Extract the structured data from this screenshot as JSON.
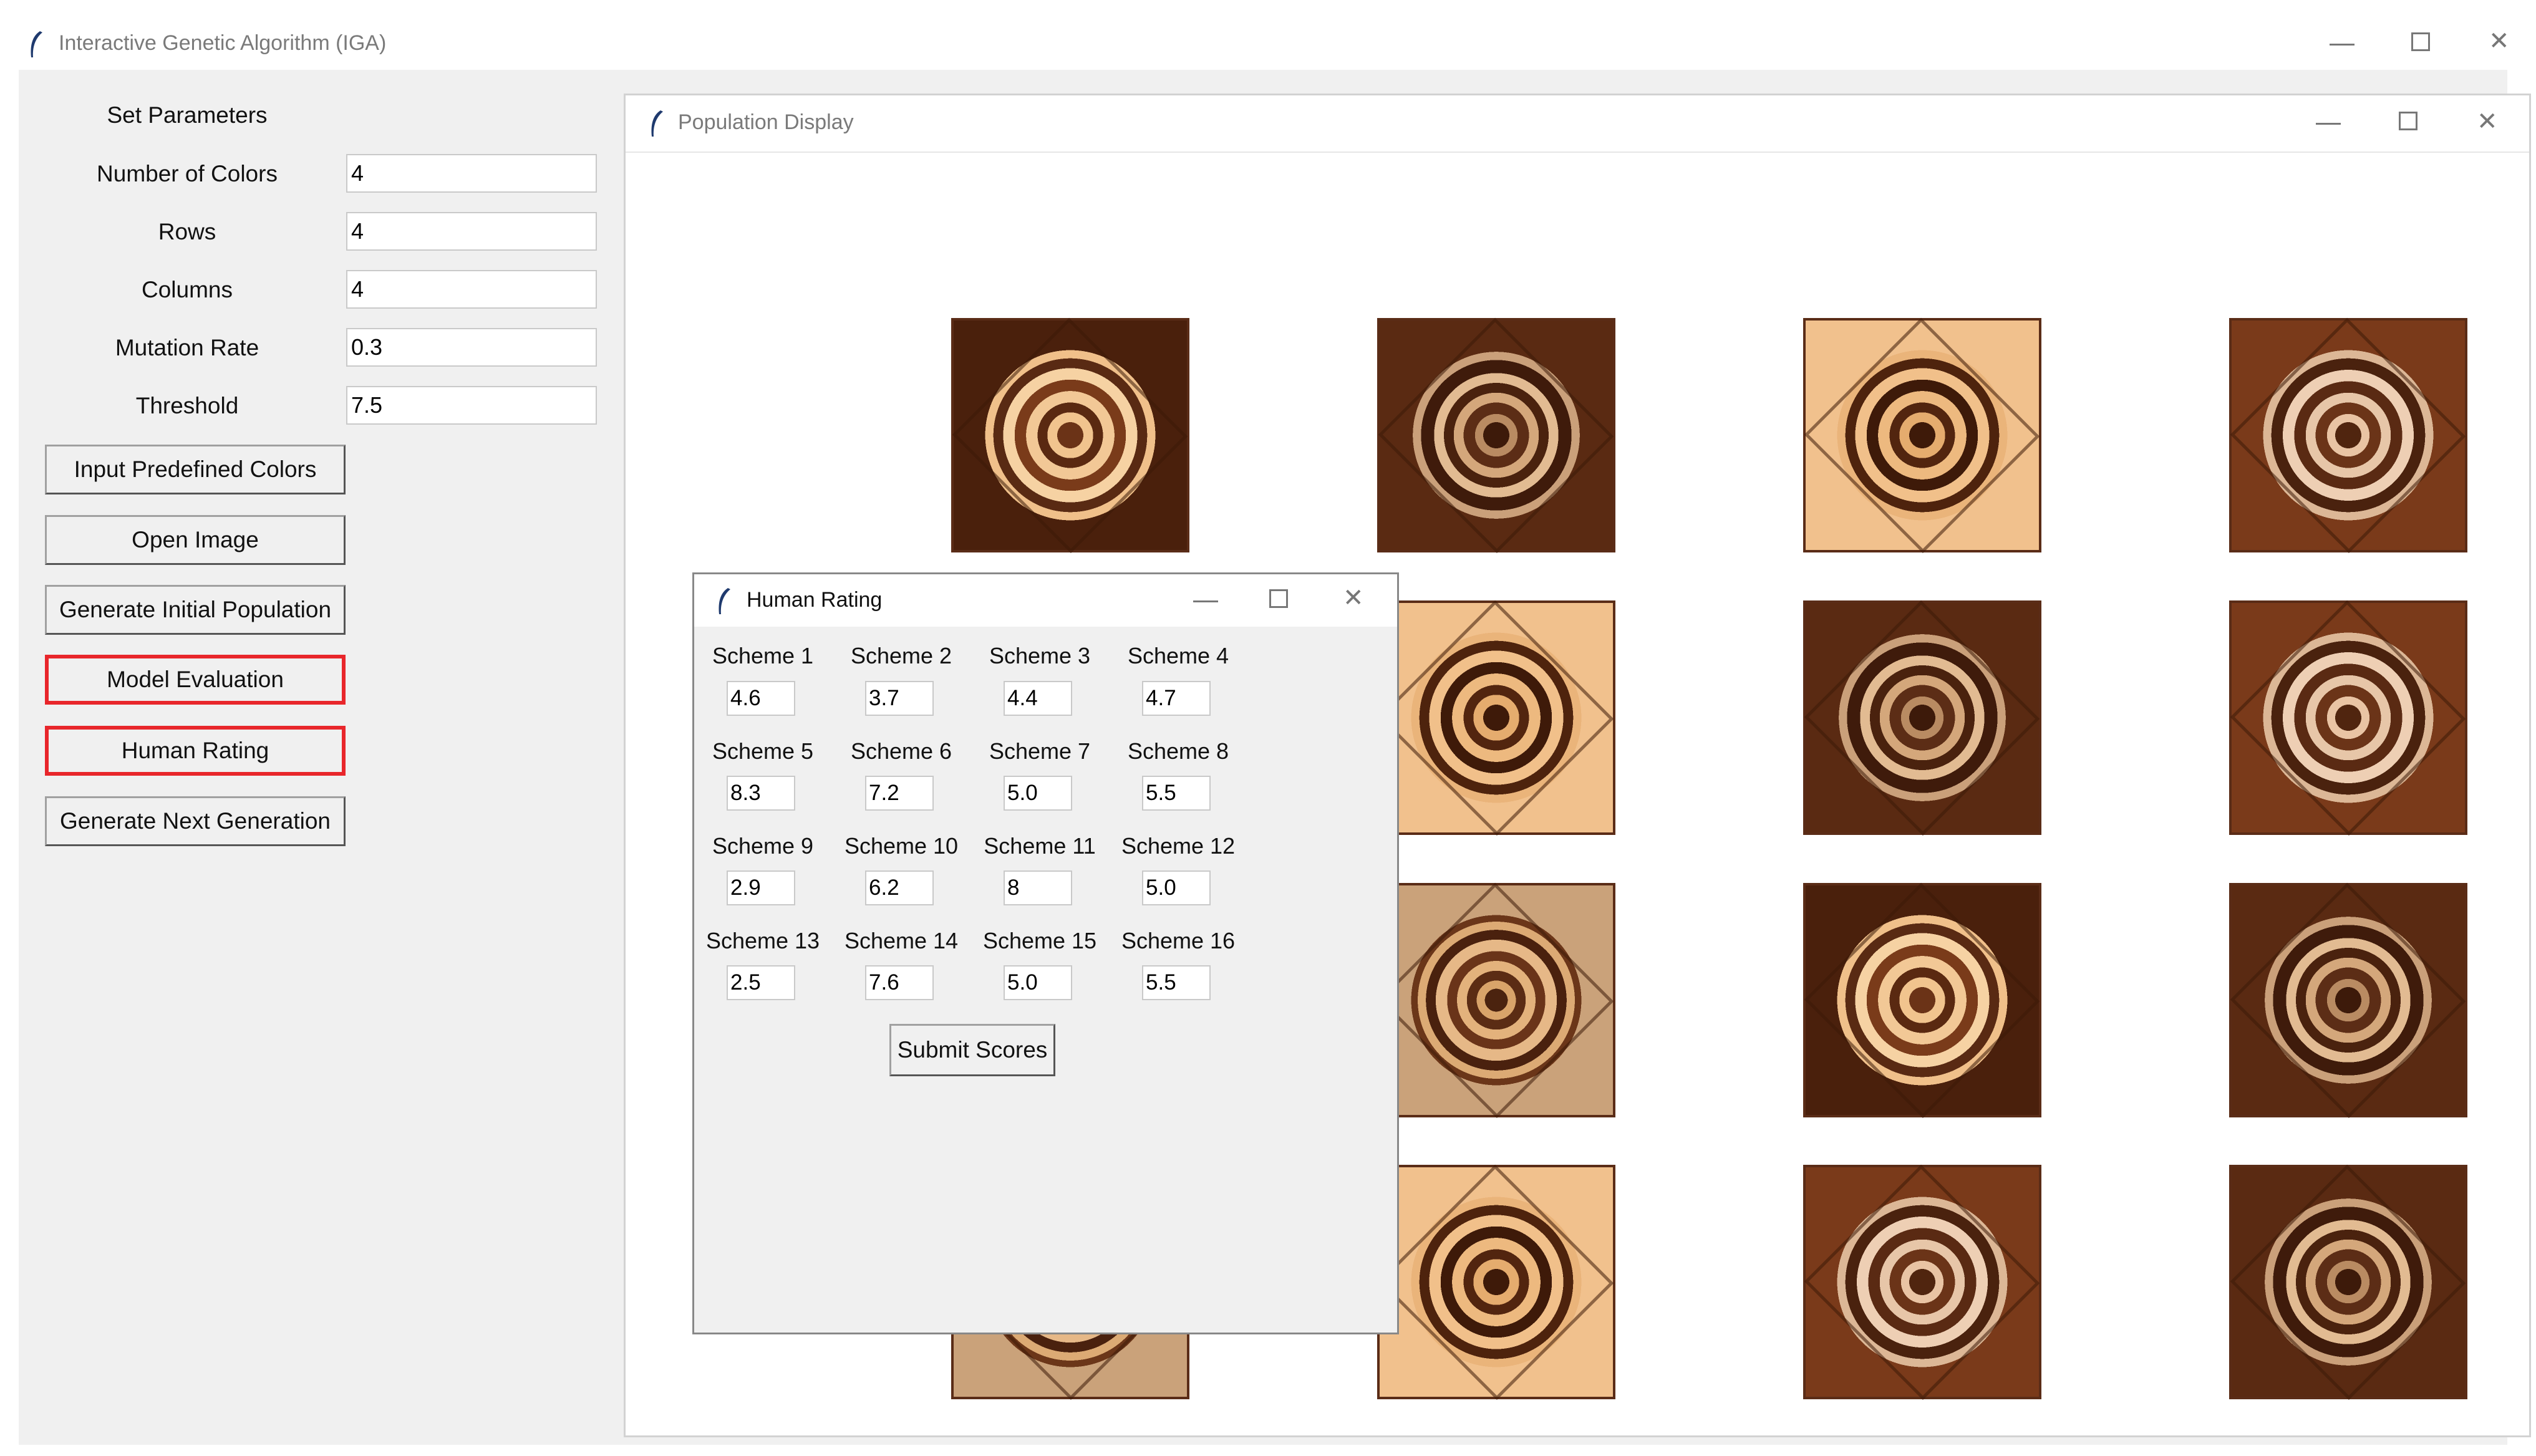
{
  "main_window": {
    "title": "Interactive Genetic Algorithm (IGA)",
    "params_heading": "Set Parameters",
    "params": [
      {
        "label": "Number of Colors",
        "value": "4"
      },
      {
        "label": "Rows",
        "value": "4"
      },
      {
        "label": "Columns",
        "value": "4"
      },
      {
        "label": "Mutation Rate",
        "value": "0.3"
      },
      {
        "label": "Threshold",
        "value": "7.5"
      }
    ],
    "buttons": [
      {
        "label": "Input Predefined Colors",
        "highlighted": false
      },
      {
        "label": "Open Image",
        "highlighted": false
      },
      {
        "label": "Generate Initial Population",
        "highlighted": false
      },
      {
        "label": "Model Evaluation",
        "highlighted": true
      },
      {
        "label": "Human Rating",
        "highlighted": true
      },
      {
        "label": "Generate Next Generation",
        "highlighted": false
      }
    ],
    "highlight_color": "#e8262b"
  },
  "population_window": {
    "title": "Population Display",
    "grid_rows": 4,
    "grid_cols": 4,
    "tile_icon": "mandala-pattern-icon"
  },
  "rating_window": {
    "title": "Human Rating",
    "schemes": [
      {
        "label": "Scheme 1",
        "score": "4.6"
      },
      {
        "label": "Scheme 2",
        "score": "3.7"
      },
      {
        "label": "Scheme 3",
        "score": "4.4"
      },
      {
        "label": "Scheme 4",
        "score": "4.7"
      },
      {
        "label": "Scheme 5",
        "score": "8.3"
      },
      {
        "label": "Scheme 6",
        "score": "7.2"
      },
      {
        "label": "Scheme 7",
        "score": "5.0"
      },
      {
        "label": "Scheme 8",
        "score": "5.5"
      },
      {
        "label": "Scheme 9",
        "score": "2.9"
      },
      {
        "label": "Scheme 10",
        "score": "6.2"
      },
      {
        "label": "Scheme 11",
        "score": "8"
      },
      {
        "label": "Scheme 12",
        "score": "5.0"
      },
      {
        "label": "Scheme 13",
        "score": "2.5"
      },
      {
        "label": "Scheme 14",
        "score": "7.6"
      },
      {
        "label": "Scheme 15",
        "score": "5.0"
      },
      {
        "label": "Scheme 16",
        "score": "5.5"
      }
    ],
    "submit_label": "Submit Scores"
  },
  "icons": {
    "app": "feather-icon",
    "minimize": "minimize-icon",
    "maximize": "maximize-icon",
    "close": "close-icon"
  }
}
